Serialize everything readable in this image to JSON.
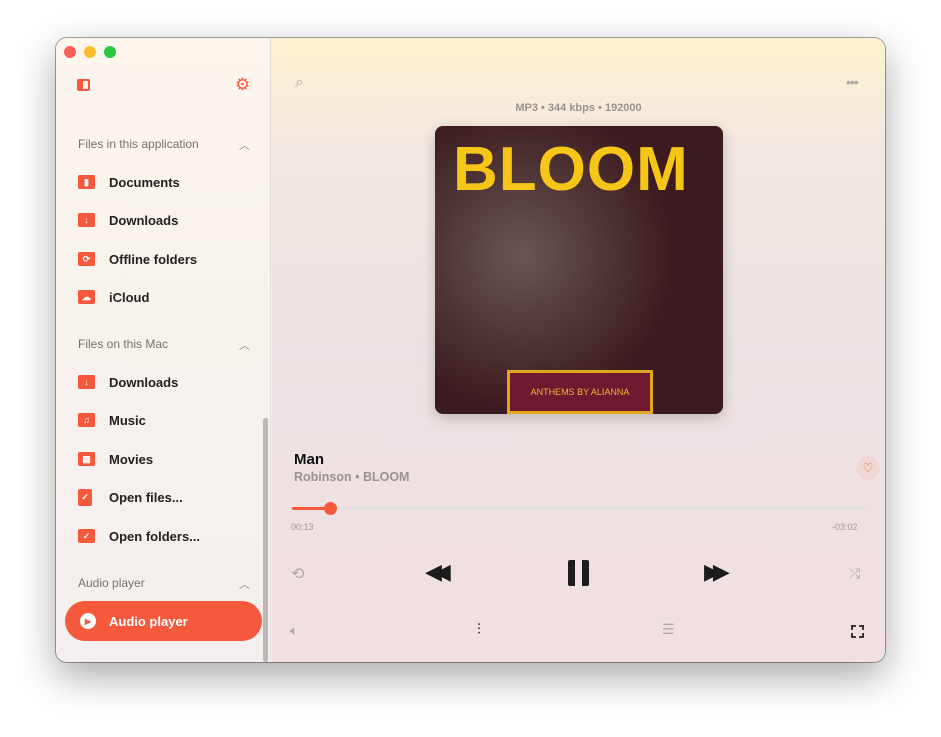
{
  "sidebar": {
    "sections": [
      {
        "title": "Files in this application",
        "items": [
          {
            "label": "Documents",
            "icon": "document-folder-icon"
          },
          {
            "label": "Downloads",
            "icon": "download-folder-icon"
          },
          {
            "label": "Offline folders",
            "icon": "sync-folder-icon"
          },
          {
            "label": "iCloud",
            "icon": "cloud-folder-icon"
          }
        ]
      },
      {
        "title": "Files on this Mac",
        "items": [
          {
            "label": "Downloads",
            "icon": "download-folder-icon"
          },
          {
            "label": "Music",
            "icon": "music-folder-icon"
          },
          {
            "label": "Movies",
            "icon": "movie-folder-icon"
          },
          {
            "label": "Open files...",
            "icon": "open-file-icon"
          },
          {
            "label": "Open folders...",
            "icon": "open-folder-icon"
          }
        ]
      },
      {
        "title": "Audio player",
        "items": [
          {
            "label": "Audio player",
            "icon": "play-circle-icon",
            "active": true
          }
        ]
      }
    ]
  },
  "player": {
    "format": "MP3 • 344 kbps • 192000",
    "album_title": "BLOOM",
    "album_subtitle": "ANTHEMS BY ALIANNA",
    "track": "Man",
    "artist_album": "Robinson • BLOOM",
    "elapsed": "00:13",
    "remaining": "-03:02",
    "progress_percent": 6.7
  },
  "colors": {
    "accent": "#f4593c"
  }
}
